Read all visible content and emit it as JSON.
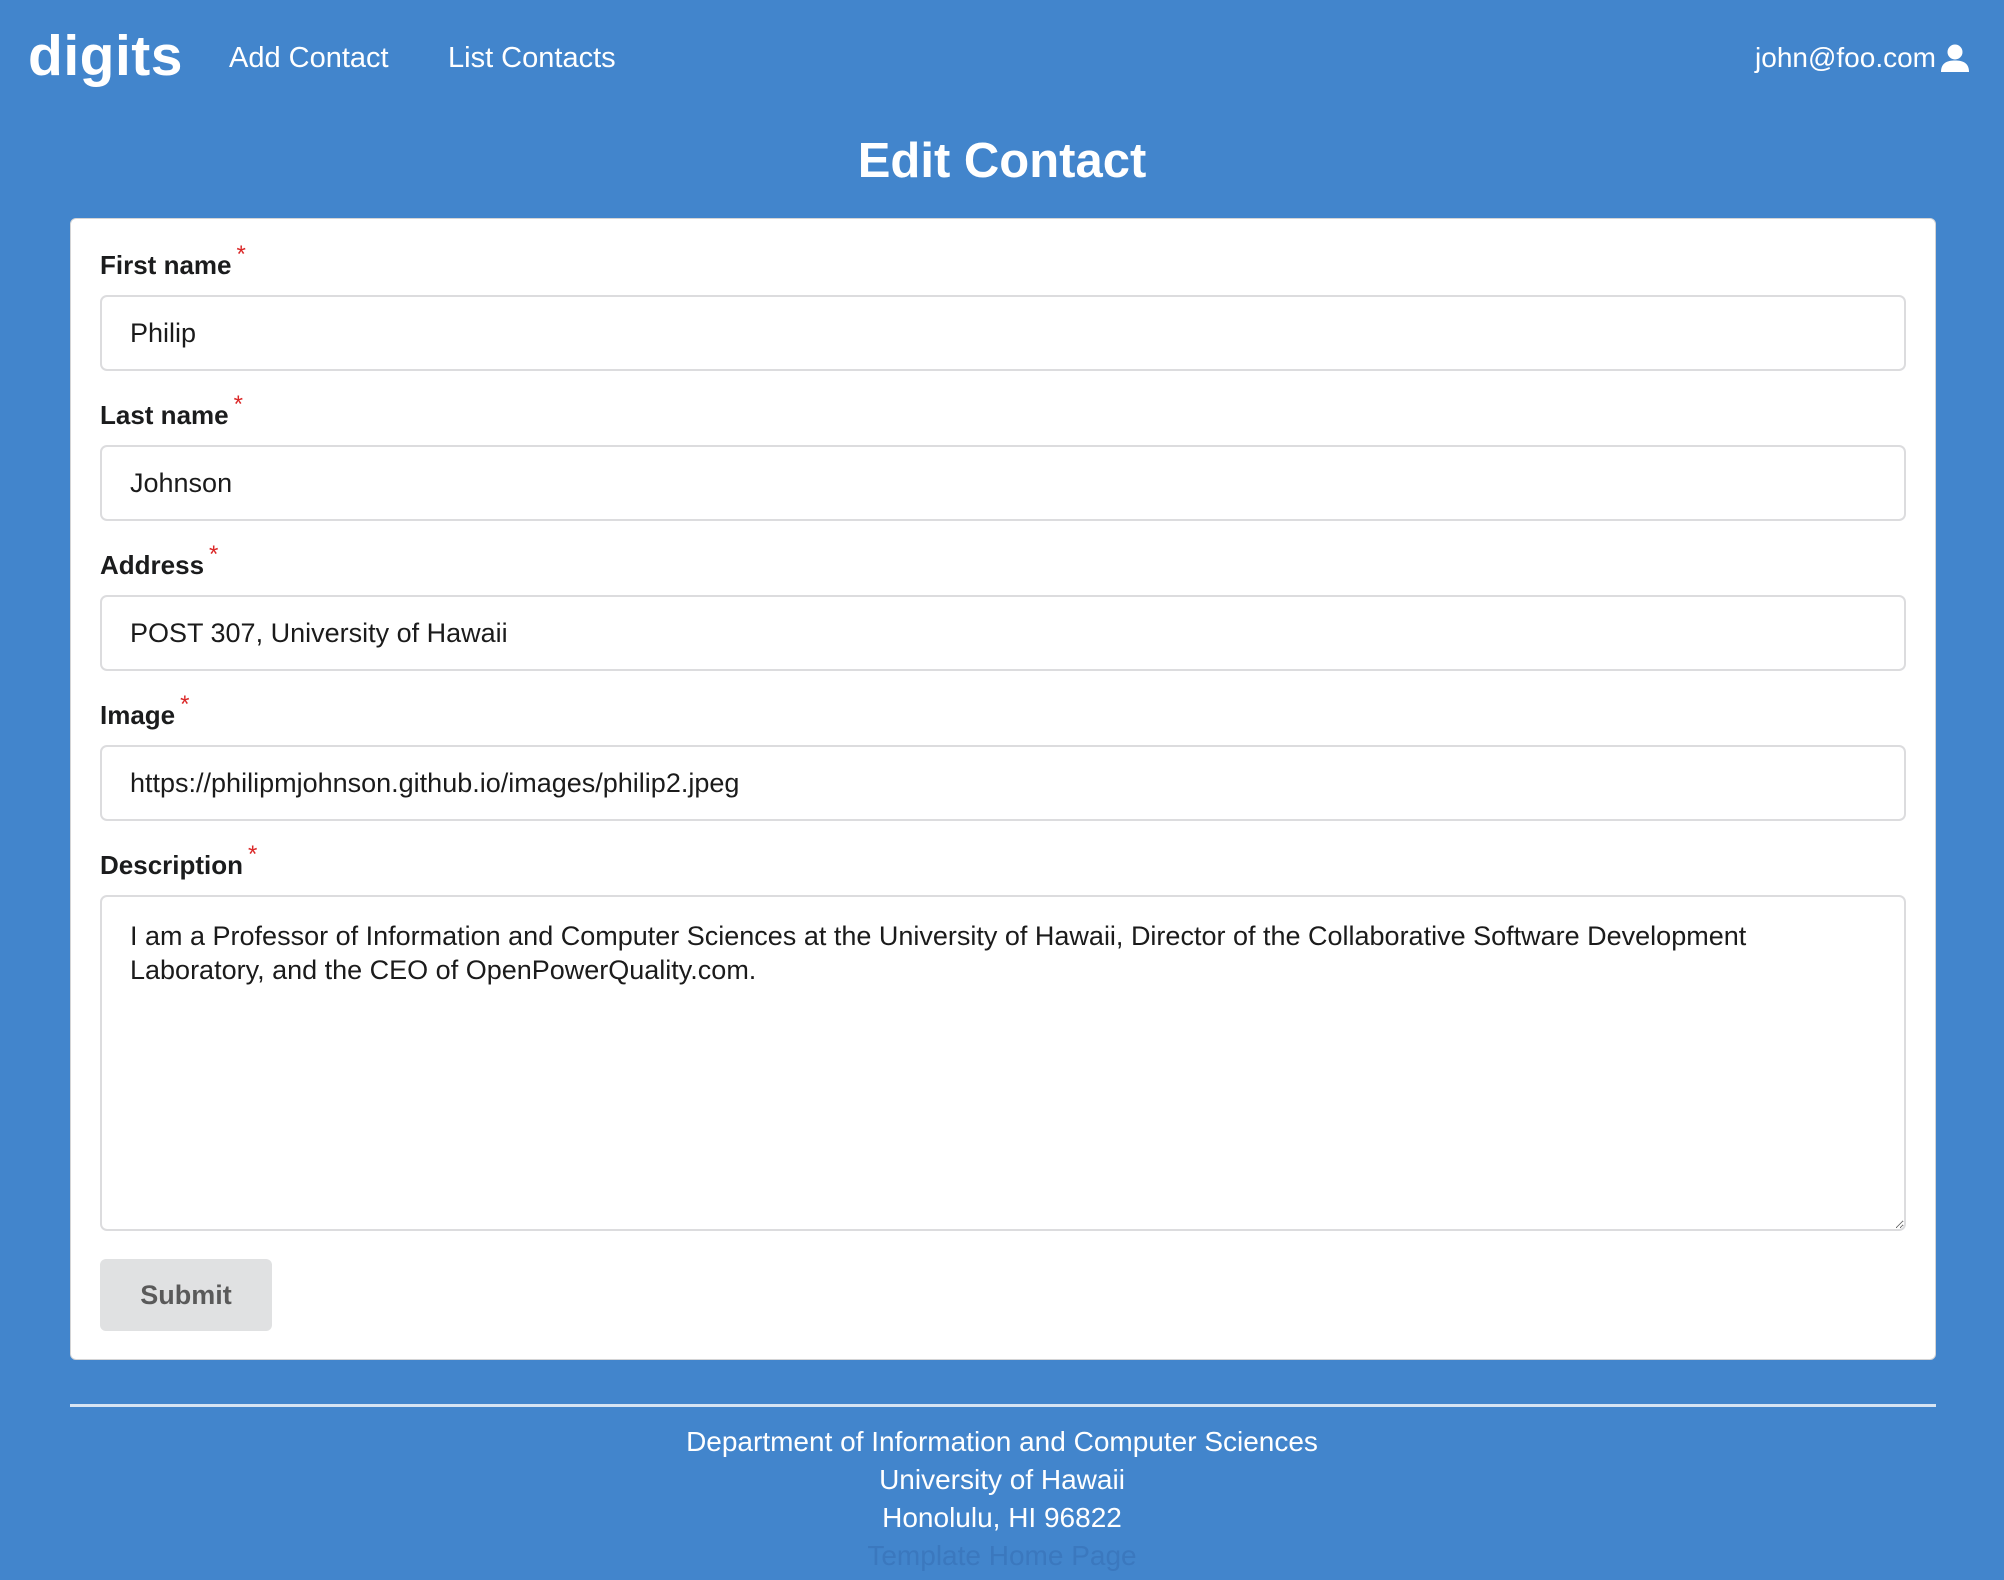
{
  "navbar": {
    "brand": "digits",
    "links": {
      "add_contact": "Add Contact",
      "list_contacts": "List Contacts"
    },
    "user_email": "john@foo.com",
    "user_icon": "user-icon"
  },
  "page": {
    "title": "Edit Contact"
  },
  "form": {
    "required_marker": "*",
    "first_name": {
      "label": "First name",
      "value": "Philip"
    },
    "last_name": {
      "label": "Last name",
      "value": "Johnson"
    },
    "address": {
      "label": "Address",
      "value": "POST 307, University of Hawaii"
    },
    "image": {
      "label": "Image",
      "value": "https://philipmjohnson.github.io/images/philip2.jpeg"
    },
    "description": {
      "label": "Description",
      "value": "I am a Professor of Information and Computer Sciences at the University of Hawaii, Director of the Collaborative Software Development Laboratory, and the CEO of OpenPowerQuality.com."
    },
    "submit_label": "Submit"
  },
  "footer": {
    "line1": "Department of Information and Computer Sciences",
    "line2": "University of Hawaii",
    "line3": "Honolulu, HI 96822",
    "link": "Template Home Page"
  },
  "colors": {
    "background": "#4285cc",
    "card": "#ffffff",
    "required": "#db2828",
    "button": "#e0e1e2"
  }
}
